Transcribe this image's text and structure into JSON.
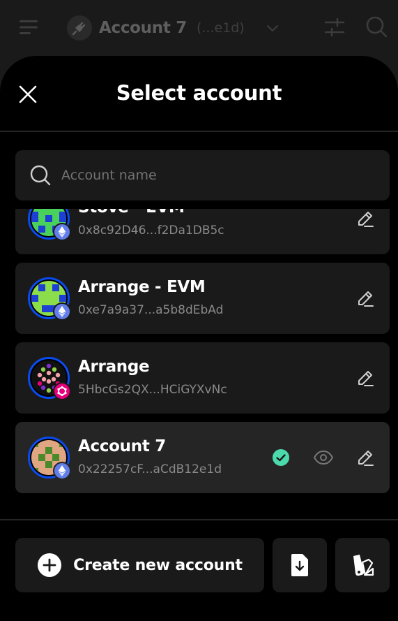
{
  "header": {
    "account_name": "Account 7",
    "account_short_address": "(...e1d)"
  },
  "modal": {
    "title": "Select account",
    "search": {
      "value": "",
      "placeholder": "Account name"
    },
    "accounts": [
      {
        "name": "Stove - EVM",
        "address": "0x8c92D46...f2Da1DB5c",
        "chain": "ethereum",
        "selected": false
      },
      {
        "name": "Arrange - EVM",
        "address": "0xe7a9a37...a5b8dEbAd",
        "chain": "ethereum",
        "selected": false
      },
      {
        "name": "Arrange",
        "address": "5HbcGs2QX...HCiGYXvNc",
        "chain": "polkadot",
        "selected": false
      },
      {
        "name": "Account 7",
        "address": "0x22257cF...aCdB12e1d",
        "chain": "ethereum",
        "selected": true
      }
    ],
    "footer": {
      "create_label": "Create new account"
    }
  },
  "colors": {
    "background": "#1a1a1a",
    "modal": "#000000",
    "card": "#1a1a1a",
    "card_selected": "#252525",
    "avatar_ring": "#0a4cf2",
    "ethereum_badge": "#627eea",
    "polkadot_badge": "#e6007a",
    "check": "#4cd9ac",
    "muted_text": "#8a8a8a"
  },
  "icons": {
    "menu": "menu-icon",
    "plug": "plug-icon",
    "settings": "sliders-icon",
    "search": "search-icon",
    "close": "close-icon",
    "edit": "pencil-icon",
    "view": "eye-icon",
    "selected": "check-circle-icon",
    "create": "plus-circle-icon",
    "import": "file-download-icon",
    "attach": "swatches-icon"
  }
}
